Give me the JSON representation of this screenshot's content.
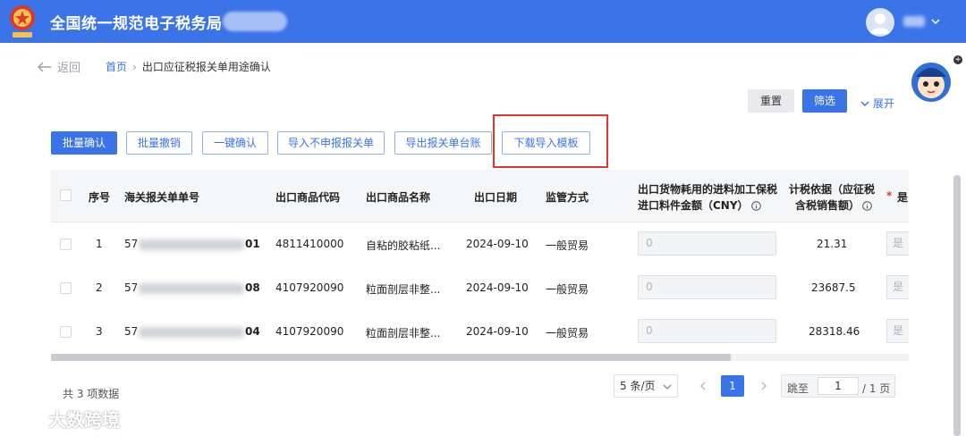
{
  "header": {
    "title": "全国统一规范电子税务局",
    "user_menu_icon": "chevron-down-icon",
    "colors": {
      "brand": "#3b73e8"
    }
  },
  "nav": {
    "back_label": "返回",
    "breadcrumb": {
      "home": "首页",
      "separator": "›",
      "current": "出口应征税报关单用途确认"
    }
  },
  "filter": {
    "reset_label": "重置",
    "search_label": "筛选",
    "expand_label": "展开"
  },
  "toolbar": {
    "buttons": [
      "批量确认",
      "批量撤销",
      "一键确认",
      "导入不申报报关单",
      "导出报关单台账",
      "下载导入模板"
    ]
  },
  "table": {
    "columns": {
      "seq": "序号",
      "decl_no": "海关报关单单号",
      "goods_code": "出口商品代码",
      "goods_name": "出口商品名称",
      "export_date": "出口日期",
      "supervision": "监管方式",
      "material_amount_l1": "出口货物耗用的进料加工保税",
      "material_amount_l2": "进口料件金额（CNY）",
      "tax_basis_l1": "计税依据（应征税",
      "tax_basis_l2": "含税销售额）",
      "required_mark": "*",
      "partial_col": "是"
    },
    "rows": [
      {
        "seq": "1",
        "decl_prefix": "57",
        "decl_suffix": "01",
        "goods_code": "4811410000",
        "goods_name": "自粘的胶粘纸...",
        "export_date": "2024-09-10",
        "supervision": "一般贸易",
        "material_amount": "0",
        "tax_basis": "21.31",
        "confirm": "是"
      },
      {
        "seq": "2",
        "decl_prefix": "57",
        "decl_suffix": "08",
        "goods_code": "4107920090",
        "goods_name": "粒面剖层非整...",
        "export_date": "2024-09-10",
        "supervision": "一般贸易",
        "material_amount": "0",
        "tax_basis": "23687.5",
        "confirm": "是"
      },
      {
        "seq": "3",
        "decl_prefix": "57",
        "decl_suffix": "04",
        "goods_code": "4107920090",
        "goods_name": "粒面剖层非整...",
        "export_date": "2024-09-10",
        "supervision": "一般贸易",
        "material_amount": "0",
        "tax_basis": "28318.46",
        "confirm": "是"
      }
    ]
  },
  "pagination": {
    "total_text": "共 3 项数据",
    "page_size": "5 条/页",
    "current_page": "1",
    "jump_label": "跳至",
    "jump_value": "1",
    "total_pages": "/ 1 页"
  },
  "watermark": {
    "text": "大数跨境"
  }
}
